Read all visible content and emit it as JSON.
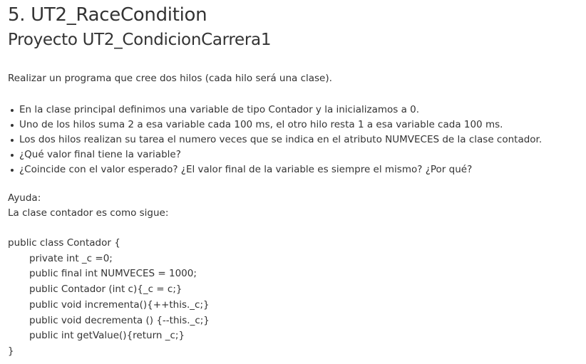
{
  "title": "5. UT2_RaceCondition",
  "subtitle": "Proyecto UT2_CondicionCarrera1",
  "intro": "Realizar un programa que cree dos hilos (cada hilo será una clase).",
  "bullets": [
    "En la clase principal definimos una variable de tipo Contador y la inicializamos a 0.",
    "Uno de los hilos suma 2 a esa variable cada 100 ms, el otro hilo resta 1 a esa variable cada 100 ms.",
    "Los dos hilos realizan su tarea el numero veces que se indica en el atributo NUMVECES de la clase contador.",
    "¿Qué valor final tiene la variable?",
    "¿Coincide con el valor esperado? ¿El valor final de la variable es siempre el mismo? ¿Por qué?"
  ],
  "help": {
    "label": "Ayuda:",
    "text": "La clase contador es como sigue:"
  },
  "code": [
    "public class Contador {",
    "private int _c =0;",
    "public final int NUMVECES = 1000;",
    "public Contador (int c){_c = c;}",
    "public void incrementa(){++this._c;}",
    "public void decrementa () {--this._c;}",
    "public int getValue(){return _c;}",
    "}"
  ]
}
